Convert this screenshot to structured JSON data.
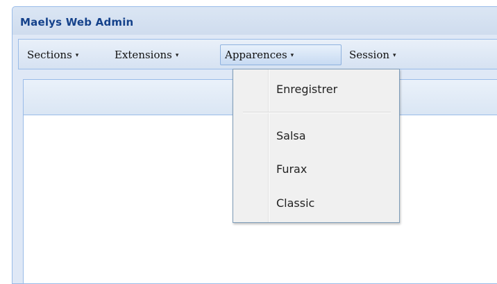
{
  "window": {
    "title": "Maelys Web Admin"
  },
  "menubar": {
    "items": [
      {
        "label": "Sections",
        "arrow": "▾"
      },
      {
        "label": "Extensions",
        "arrow": "▾"
      },
      {
        "label": "Apparences",
        "arrow": "▾"
      },
      {
        "label": "Session",
        "arrow": "▾"
      }
    ],
    "active_item": "Apparences"
  },
  "dropdown": {
    "items": [
      {
        "label": "Enregistrer"
      },
      {
        "label": "Salsa"
      },
      {
        "label": "Furax"
      },
      {
        "label": "Classic"
      }
    ]
  },
  "colors": {
    "title": "#15428b",
    "border": "#99bbe8",
    "panel_bg": "#dfe8f6"
  }
}
